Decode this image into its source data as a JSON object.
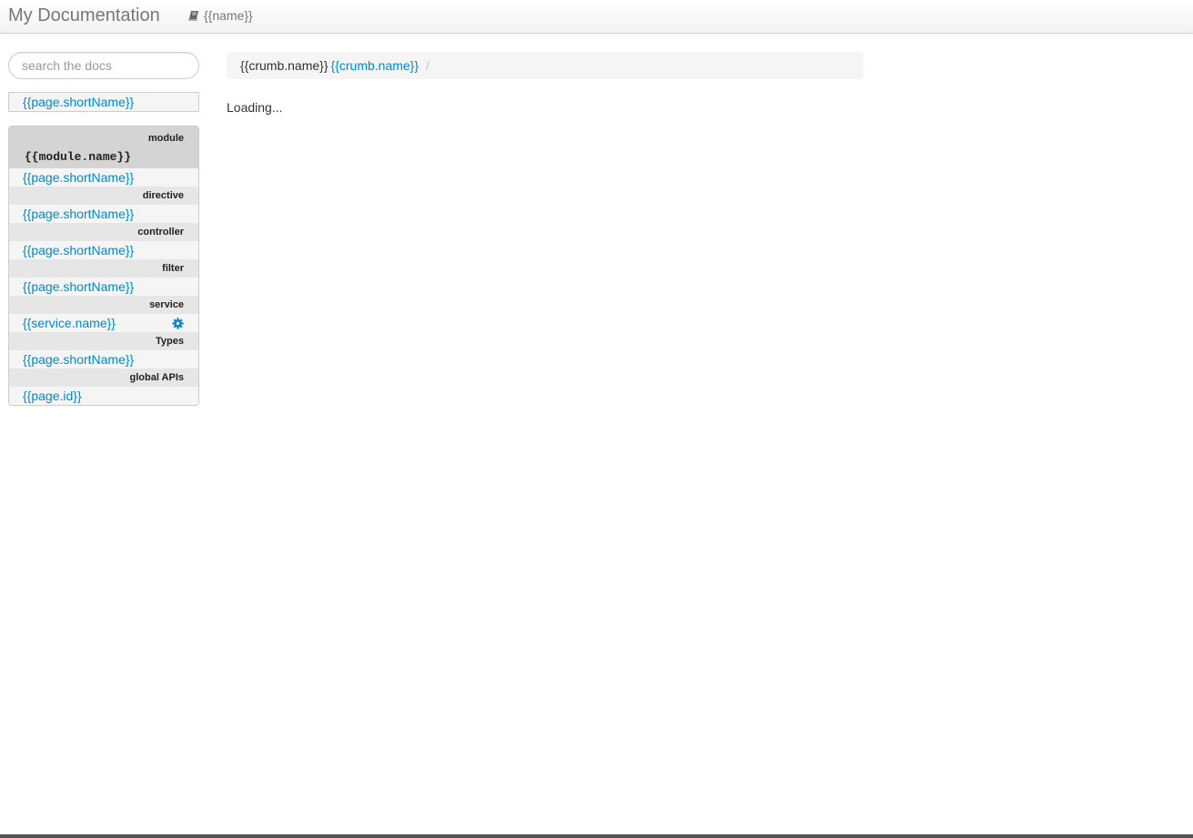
{
  "navbar": {
    "brand": "My Documentation",
    "link_label": "{{name}}",
    "link_icon": "book-icon"
  },
  "sidebar": {
    "search": {
      "placeholder": "search the docs",
      "value": ""
    },
    "single_item": "{{page.shortName}}",
    "module": {
      "section_title": "module",
      "name": "{{module.name}}",
      "first_link": "{{page.shortName}}",
      "sections": [
        {
          "title": "directive",
          "link": "{{page.shortName}}"
        },
        {
          "title": "controller",
          "link": "{{page.shortName}}"
        },
        {
          "title": "filter",
          "link": "{{page.shortName}}"
        },
        {
          "title": "service",
          "link": "{{service.name}}",
          "icon": "gear-icon"
        },
        {
          "title": "Types",
          "link": "{{page.shortName}}"
        },
        {
          "title": "global APIs",
          "link": "{{page.id}}"
        }
      ]
    }
  },
  "main": {
    "breadcrumb": {
      "current": "{{crumb.name}}",
      "link": "{{crumb.name}}",
      "divider": "/"
    },
    "loading_text": "Loading..."
  },
  "colors": {
    "link": "#0088cc",
    "navbar_text": "#777777",
    "section_header_bg": "#e6e6e6",
    "module_header_bg": "#d4d4d4"
  }
}
